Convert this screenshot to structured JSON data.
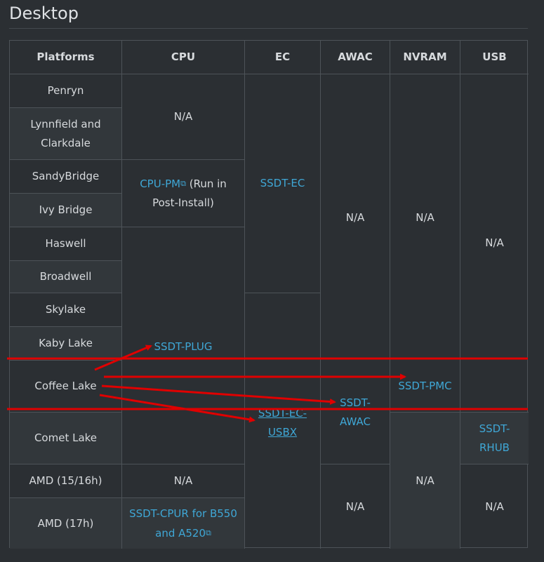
{
  "title": "Desktop",
  "headers": [
    "Platforms",
    "CPU",
    "EC",
    "AWAC",
    "NVRAM",
    "USB"
  ],
  "platforms": [
    "Penryn",
    "Lynnfield and Clarkdale",
    "SandyBridge",
    "Ivy Bridge",
    "Haswell",
    "Broadwell",
    "Skylake",
    "Kaby Lake",
    "Coffee Lake",
    "Comet Lake",
    "AMD (15/16h)",
    "AMD (17h)"
  ],
  "cells": {
    "cpu_na_1": "N/A",
    "cpu_pm_link": "CPU-PM",
    "cpu_pm_note": " (Run in Post-Install)",
    "cpu_plug": "SSDT-PLUG",
    "cpu_na_amd15": "N/A",
    "cpu_cpur": "SSDT-CPUR for B550 and A520",
    "ec_ssdt": "SSDT-EC",
    "ec_usbx": "SSDT-EC-USBX",
    "awac_na_1": "N/A",
    "awac_ssdt": "SSDT-AWAC",
    "awac_na_2": "N/A",
    "nvram_na_1": "N/A",
    "nvram_pmc": "SSDT-PMC",
    "nvram_na_2": "N/A",
    "usb_na_1": "N/A",
    "usb_rhub": "SSDT-RHUB",
    "usb_na_2": "N/A"
  },
  "icons": {
    "external": "external-link-icon"
  },
  "colors": {
    "link": "#3fa7d6",
    "annotation": "#e00000",
    "background": "#2b2f33"
  }
}
